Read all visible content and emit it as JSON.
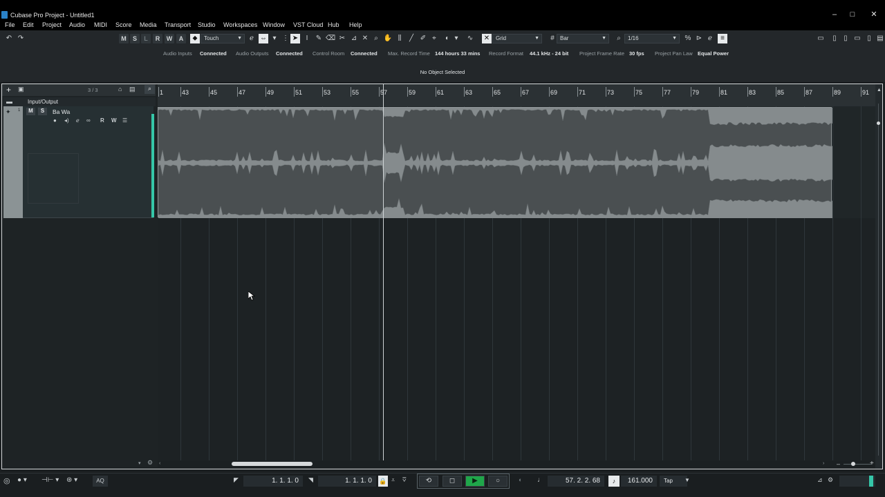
{
  "window": {
    "title": "Cubase Pro Project - Untitled1",
    "controls": [
      "–",
      "□",
      "✕"
    ]
  },
  "menu": [
    "File",
    "Edit",
    "Project",
    "Audio",
    "MIDI",
    "Score",
    "Media",
    "Transport",
    "Studio",
    "Workspaces",
    "Window",
    "VST Cloud",
    "Hub",
    "Help"
  ],
  "toolbar": {
    "undo_icon": "undo-icon",
    "redo_icon": "redo-icon",
    "state_buttons": [
      "M",
      "S",
      "L",
      "R",
      "W",
      "A"
    ],
    "automation_mode": "Touch",
    "snap_mode": "Grid",
    "grid_type": "Bar",
    "quantize": "1/16"
  },
  "status": [
    {
      "label": "Audio Inputs",
      "value": "Connected"
    },
    {
      "label": "Audio Outputs",
      "value": "Connected"
    },
    {
      "label": "Control Room",
      "value": "Connected"
    },
    {
      "label": "Max. Record Time",
      "value": "144 hours 33 mins"
    },
    {
      "label": "Record Format",
      "value": "44.1 kHz - 24 bit"
    },
    {
      "label": "Project Frame Rate",
      "value": "30 fps"
    },
    {
      "label": "Project Pan Law",
      "value": "Equal Power"
    }
  ],
  "info_line": "No Object Selected",
  "track_list": {
    "count": "3 / 3",
    "folder_name": "Input/Output",
    "tracks": [
      {
        "number": "1",
        "name": "Ba Wa",
        "mute": "M",
        "solo": "S",
        "read": "R",
        "write": "W"
      }
    ]
  },
  "ruler_bars": [
    "1",
    "43",
    "45",
    "47",
    "49",
    "51",
    "53",
    "55",
    "57",
    "59",
    "61",
    "63",
    "65",
    "67",
    "69",
    "71",
    "73",
    "75",
    "77",
    "79",
    "81",
    "83",
    "85",
    "87",
    "89",
    "91"
  ],
  "transport": {
    "left_locator": "1. 1. 1.   0",
    "right_locator": "1. 1. 1.   0",
    "position": "57. 2. 2. 68",
    "tempo": "161.000",
    "tap": "Tap",
    "aq": "AQ"
  },
  "colors": {
    "accent_play": "#1fa64a",
    "event_bg": "#4a4f51",
    "track_color": "#8b9395",
    "meter": "#35c6a8"
  }
}
